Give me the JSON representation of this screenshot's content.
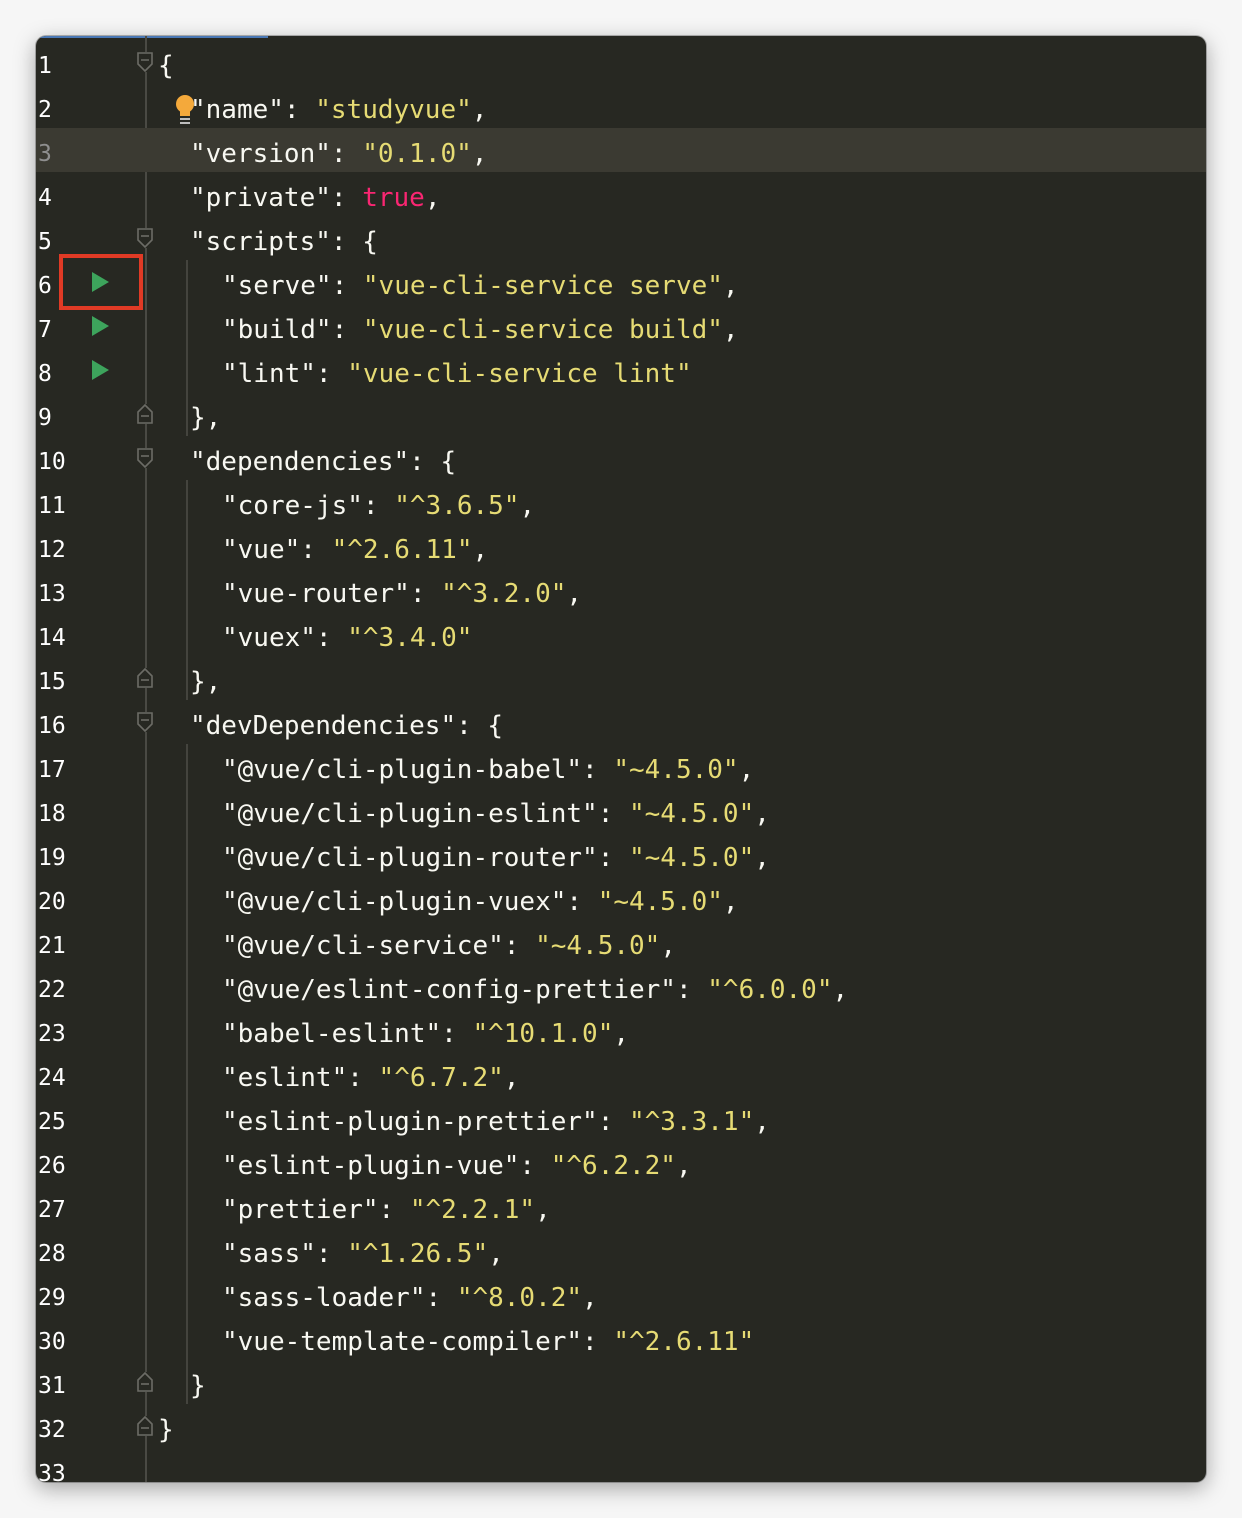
{
  "editor": {
    "current_line": 3,
    "lines": [
      {
        "num": "1",
        "indent": 0,
        "tokens": [
          {
            "t": "p",
            "v": "{"
          }
        ],
        "fold": "open"
      },
      {
        "num": "2",
        "indent": 1,
        "tokens": [
          {
            "t": "k",
            "v": "\"name\""
          },
          {
            "t": "p",
            "v": ": "
          },
          {
            "t": "s",
            "v": "\"studyvue\""
          },
          {
            "t": "p",
            "v": ","
          }
        ]
      },
      {
        "num": "3",
        "indent": 1,
        "tokens": [
          {
            "t": "k",
            "v": "\"version\""
          },
          {
            "t": "p",
            "v": ": "
          },
          {
            "t": "s",
            "v": "\"0.1.0\""
          },
          {
            "t": "p",
            "v": ","
          }
        ]
      },
      {
        "num": "4",
        "indent": 1,
        "tokens": [
          {
            "t": "k",
            "v": "\"private\""
          },
          {
            "t": "p",
            "v": ": "
          },
          {
            "t": "b",
            "v": "true"
          },
          {
            "t": "p",
            "v": ","
          }
        ]
      },
      {
        "num": "5",
        "indent": 1,
        "tokens": [
          {
            "t": "k",
            "v": "\"scripts\""
          },
          {
            "t": "p",
            "v": ": {"
          }
        ],
        "fold": "open"
      },
      {
        "num": "6",
        "indent": 2,
        "tokens": [
          {
            "t": "k",
            "v": "\"serve\""
          },
          {
            "t": "p",
            "v": ": "
          },
          {
            "t": "s",
            "v": "\"vue-cli-service serve\""
          },
          {
            "t": "p",
            "v": ","
          }
        ],
        "run": true
      },
      {
        "num": "7",
        "indent": 2,
        "tokens": [
          {
            "t": "k",
            "v": "\"build\""
          },
          {
            "t": "p",
            "v": ": "
          },
          {
            "t": "s",
            "v": "\"vue-cli-service build\""
          },
          {
            "t": "p",
            "v": ","
          }
        ],
        "run": true
      },
      {
        "num": "8",
        "indent": 2,
        "tokens": [
          {
            "t": "k",
            "v": "\"lint\""
          },
          {
            "t": "p",
            "v": ": "
          },
          {
            "t": "s",
            "v": "\"vue-cli-service lint\""
          }
        ],
        "run": true
      },
      {
        "num": "9",
        "indent": 1,
        "tokens": [
          {
            "t": "p",
            "v": "},"
          }
        ],
        "fold": "close"
      },
      {
        "num": "10",
        "indent": 1,
        "tokens": [
          {
            "t": "k",
            "v": "\"dependencies\""
          },
          {
            "t": "p",
            "v": ": {"
          }
        ],
        "fold": "open"
      },
      {
        "num": "11",
        "indent": 2,
        "tokens": [
          {
            "t": "k",
            "v": "\"core-js\""
          },
          {
            "t": "p",
            "v": ": "
          },
          {
            "t": "s",
            "v": "\"^3.6.5\""
          },
          {
            "t": "p",
            "v": ","
          }
        ]
      },
      {
        "num": "12",
        "indent": 2,
        "tokens": [
          {
            "t": "k",
            "v": "\"vue\""
          },
          {
            "t": "p",
            "v": ": "
          },
          {
            "t": "s",
            "v": "\"^2.6.11\""
          },
          {
            "t": "p",
            "v": ","
          }
        ]
      },
      {
        "num": "13",
        "indent": 2,
        "tokens": [
          {
            "t": "k",
            "v": "\"vue-router\""
          },
          {
            "t": "p",
            "v": ": "
          },
          {
            "t": "s",
            "v": "\"^3.2.0\""
          },
          {
            "t": "p",
            "v": ","
          }
        ]
      },
      {
        "num": "14",
        "indent": 2,
        "tokens": [
          {
            "t": "k",
            "v": "\"vuex\""
          },
          {
            "t": "p",
            "v": ": "
          },
          {
            "t": "s",
            "v": "\"^3.4.0\""
          }
        ]
      },
      {
        "num": "15",
        "indent": 1,
        "tokens": [
          {
            "t": "p",
            "v": "},"
          }
        ],
        "fold": "close"
      },
      {
        "num": "16",
        "indent": 1,
        "tokens": [
          {
            "t": "k",
            "v": "\"devDependencies\""
          },
          {
            "t": "p",
            "v": ": {"
          }
        ],
        "fold": "open"
      },
      {
        "num": "17",
        "indent": 2,
        "tokens": [
          {
            "t": "k",
            "v": "\"@vue/cli-plugin-babel\""
          },
          {
            "t": "p",
            "v": ": "
          },
          {
            "t": "s",
            "v": "\"~4.5.0\""
          },
          {
            "t": "p",
            "v": ","
          }
        ]
      },
      {
        "num": "18",
        "indent": 2,
        "tokens": [
          {
            "t": "k",
            "v": "\"@vue/cli-plugin-eslint\""
          },
          {
            "t": "p",
            "v": ": "
          },
          {
            "t": "s",
            "v": "\"~4.5.0\""
          },
          {
            "t": "p",
            "v": ","
          }
        ]
      },
      {
        "num": "19",
        "indent": 2,
        "tokens": [
          {
            "t": "k",
            "v": "\"@vue/cli-plugin-router\""
          },
          {
            "t": "p",
            "v": ": "
          },
          {
            "t": "s",
            "v": "\"~4.5.0\""
          },
          {
            "t": "p",
            "v": ","
          }
        ]
      },
      {
        "num": "20",
        "indent": 2,
        "tokens": [
          {
            "t": "k",
            "v": "\"@vue/cli-plugin-vuex\""
          },
          {
            "t": "p",
            "v": ": "
          },
          {
            "t": "s",
            "v": "\"~4.5.0\""
          },
          {
            "t": "p",
            "v": ","
          }
        ]
      },
      {
        "num": "21",
        "indent": 2,
        "tokens": [
          {
            "t": "k",
            "v": "\"@vue/cli-service\""
          },
          {
            "t": "p",
            "v": ": "
          },
          {
            "t": "s",
            "v": "\"~4.5.0\""
          },
          {
            "t": "p",
            "v": ","
          }
        ]
      },
      {
        "num": "22",
        "indent": 2,
        "tokens": [
          {
            "t": "k",
            "v": "\"@vue/eslint-config-prettier\""
          },
          {
            "t": "p",
            "v": ": "
          },
          {
            "t": "s",
            "v": "\"^6.0.0\""
          },
          {
            "t": "p",
            "v": ","
          }
        ]
      },
      {
        "num": "23",
        "indent": 2,
        "tokens": [
          {
            "t": "k",
            "v": "\"babel-eslint\""
          },
          {
            "t": "p",
            "v": ": "
          },
          {
            "t": "s",
            "v": "\"^10.1.0\""
          },
          {
            "t": "p",
            "v": ","
          }
        ]
      },
      {
        "num": "24",
        "indent": 2,
        "tokens": [
          {
            "t": "k",
            "v": "\"eslint\""
          },
          {
            "t": "p",
            "v": ": "
          },
          {
            "t": "s",
            "v": "\"^6.7.2\""
          },
          {
            "t": "p",
            "v": ","
          }
        ]
      },
      {
        "num": "25",
        "indent": 2,
        "tokens": [
          {
            "t": "k",
            "v": "\"eslint-plugin-prettier\""
          },
          {
            "t": "p",
            "v": ": "
          },
          {
            "t": "s",
            "v": "\"^3.3.1\""
          },
          {
            "t": "p",
            "v": ","
          }
        ]
      },
      {
        "num": "26",
        "indent": 2,
        "tokens": [
          {
            "t": "k",
            "v": "\"eslint-plugin-vue\""
          },
          {
            "t": "p",
            "v": ": "
          },
          {
            "t": "s",
            "v": "\"^6.2.2\""
          },
          {
            "t": "p",
            "v": ","
          }
        ]
      },
      {
        "num": "27",
        "indent": 2,
        "tokens": [
          {
            "t": "k",
            "v": "\"prettier\""
          },
          {
            "t": "p",
            "v": ": "
          },
          {
            "t": "s",
            "v": "\"^2.2.1\""
          },
          {
            "t": "p",
            "v": ","
          }
        ]
      },
      {
        "num": "28",
        "indent": 2,
        "tokens": [
          {
            "t": "k",
            "v": "\"sass\""
          },
          {
            "t": "p",
            "v": ": "
          },
          {
            "t": "s",
            "v": "\"^1.26.5\""
          },
          {
            "t": "p",
            "v": ","
          }
        ]
      },
      {
        "num": "29",
        "indent": 2,
        "tokens": [
          {
            "t": "k",
            "v": "\"sass-loader\""
          },
          {
            "t": "p",
            "v": ": "
          },
          {
            "t": "s",
            "v": "\"^8.0.2\""
          },
          {
            "t": "p",
            "v": ","
          }
        ]
      },
      {
        "num": "30",
        "indent": 2,
        "tokens": [
          {
            "t": "k",
            "v": "\"vue-template-compiler\""
          },
          {
            "t": "p",
            "v": ": "
          },
          {
            "t": "s",
            "v": "\"^2.6.11\""
          }
        ]
      },
      {
        "num": "31",
        "indent": 1,
        "tokens": [
          {
            "t": "p",
            "v": "}"
          }
        ],
        "fold": "close"
      },
      {
        "num": "32",
        "indent": 0,
        "tokens": [
          {
            "t": "p",
            "v": "}"
          }
        ],
        "fold": "close"
      },
      {
        "num": "33",
        "indent": 0,
        "tokens": []
      }
    ],
    "colors": {
      "background": "#272822",
      "key": "#f8f8f2",
      "string": "#e6db74",
      "boolean": "#f92672",
      "run_icon": "#3da45c",
      "annotation_box": "#e03a25",
      "bulb": "#f4a93b"
    },
    "icons": {
      "run": "run-play-icon",
      "fold": "fold-icon",
      "hint": "lightbulb-icon"
    },
    "annotation": {
      "target_line": "6",
      "shape": "red-rectangle"
    }
  }
}
